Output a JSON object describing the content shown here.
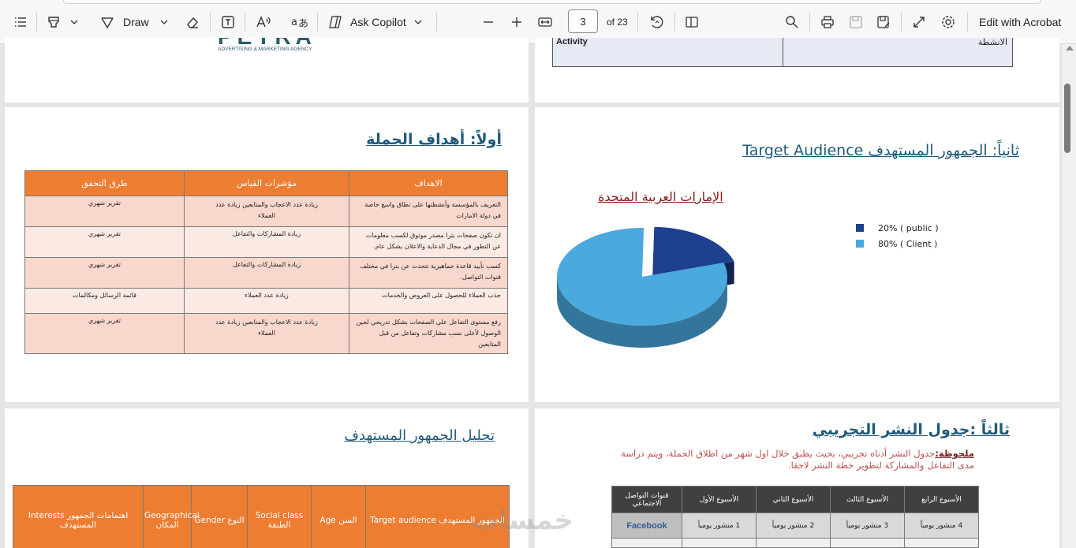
{
  "toolbar": {
    "draw_label": "Draw",
    "copilot_label": "Ask Copilot",
    "page_current": "3",
    "page_of": "of 23",
    "edit_label": "Edit with Acrobat"
  },
  "page1": {
    "logo_text": "PETRA",
    "logo_sub": "ADVERTISING & MARKETING AGENCY"
  },
  "page2": {
    "activity_en": "Activity",
    "activity_ar": "الانشطة"
  },
  "page3": {
    "title": "أولاً: أهداف الحملة",
    "headers": [
      "الاهداف",
      "مؤشرات القياس",
      "طرق التحقق"
    ],
    "rows": [
      {
        "goal": "التعريف بالمؤسسة وأنشطتها على نطاق واسع خاصة في دولة الامارات",
        "kpi": "زيادة عدد الاعجاب والمتابعين زيادة عدد العملاء",
        "method": "تقرير شهري"
      },
      {
        "goal": "ان تكون صفحات بترا مصدر موثوق لكسب معلومات عن التطور في مجال الدعاية والاعلان بشكل عام.",
        "kpi": "زيادة المشاركات والتفاعل",
        "method": "تقرير شهري"
      },
      {
        "goal": "كسب تأييد قاعدة جماهيرية تتحدث عن بترا في مختلف قنوات التواصل.",
        "kpi": "زيادة المشاركات والتفاعل",
        "method": "تقرير شهري"
      },
      {
        "goal": "جذب العملاء للحصول على العروض والخدمات",
        "kpi": "زيادة عدد العملاء",
        "method": "قائمة الرسائل ومكالمات"
      },
      {
        "goal": "رفع مستوى التفاعل على الصفحات بشكل تدريجي لحين الوصول لأعلى نسب مشاركات وتفاعل من قبل المتابعين",
        "kpi": "زيادة عدد الاعجاب والمتابعين زيادة عدد العملاء",
        "method": "تقرير شهري"
      }
    ]
  },
  "page4": {
    "title": "ثانياً: الجمهور المستهدف  Target Audience",
    "subtitle": "الإمارات العربية المتحدة",
    "legend": [
      "20%  ( public )",
      "80% ( Client )"
    ]
  },
  "chart_data": {
    "type": "pie",
    "title": "الإمارات العربية المتحدة",
    "categories": [
      "public",
      "Client"
    ],
    "values": [
      20,
      80
    ],
    "colors": [
      "#1f3f8f",
      "#4aa9dd"
    ],
    "legend_position": "right"
  },
  "page5": {
    "title": "تحليل الجمهور المستهدف",
    "headers": [
      "Target audience الجمهور المستهدف",
      "Age السن",
      "Social class الطبقة",
      "Gender النوع",
      "Geographical المكان",
      "Interests اهتمامات الجمهور المستهدف"
    ]
  },
  "page6": {
    "title": "ثالثاً :جدول النشر التجريبي",
    "note_label": "ملحوظة:",
    "note_text": "جدول النشر أدناه تجريبي، بحيث يطبق خلال اول شهر من اطلاق الحملة، ويتم دراسة مدى التفاعل والمشاركة لتطوير خطة النشر لاحقا.",
    "headers": [
      "الأسبوع الرابع",
      "الأسبوع الثالث",
      "الأسبوع الثاني",
      "الأسبوع الأول",
      "قنوات التواصل الاجتماعي"
    ],
    "row1": [
      "4 منشور يومياً",
      "3 منشور يومياً",
      "2 منشور يومياً",
      "1 منشور يومياً",
      "Facebook"
    ]
  },
  "watermark": "خمسات"
}
